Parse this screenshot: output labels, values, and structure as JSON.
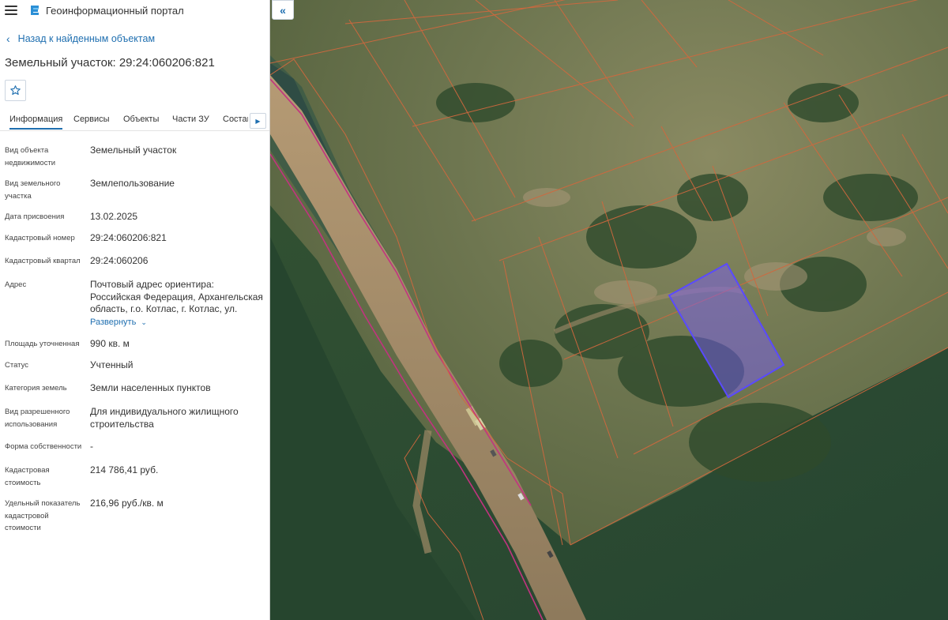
{
  "app": {
    "title": "Геоинформационный портал"
  },
  "nav": {
    "back_label": "Назад к найденным объектам"
  },
  "page_title": "Земельный участок: 29:24:060206:821",
  "tabs": [
    {
      "label": "Информация",
      "active": true
    },
    {
      "label": "Сервисы",
      "active": false
    },
    {
      "label": "Объекты",
      "active": false
    },
    {
      "label": "Части ЗУ",
      "active": false
    },
    {
      "label": "Состав",
      "active": false
    }
  ],
  "properties": [
    {
      "label": "Вид объекта недвижимости",
      "value": "Земельный участок"
    },
    {
      "label": "Вид земельного участка",
      "value": "Землепользование"
    },
    {
      "label": "Дата присвоения",
      "value": "13.02.2025"
    },
    {
      "label": "Кадастровый номер",
      "value": "29:24:060206:821"
    },
    {
      "label": "Кадастровый квартал",
      "value": "29:24:060206"
    },
    {
      "label": "Адрес",
      "value": "Почтовый адрес ориентира: Российская Федерация, Архангельская область, г.о. Котлас, г. Котлас, ул.",
      "expand_label": "Развернуть"
    },
    {
      "label": "Площадь уточненная",
      "value": "990 кв. м"
    },
    {
      "label": "Статус",
      "value": "Учтенный"
    },
    {
      "label": "Категория земель",
      "value": "Земли населенных пунктов"
    },
    {
      "label": "Вид разрешенного использования",
      "value": "Для индивидуального жилищного строительства"
    },
    {
      "label": "Форма собственности",
      "value": "-"
    },
    {
      "label": "Кадастровая стоимость",
      "value": "214 786,41 руб."
    },
    {
      "label": "Удельный показатель кадастровой стоимости",
      "value": "216,96 руб./кв. м"
    }
  ],
  "icons": {
    "menu": "hamburger-icon",
    "logo": "portal-logo-icon",
    "back": "chevron-left-icon",
    "favorite": "star-outline-icon",
    "tabs_next": "triangle-right-icon",
    "collapse": "double-chevron-left-icon"
  },
  "colors": {
    "accent": "#1f6fb0",
    "parcel_lines": "#d0683e",
    "selected_parcel_fill": "#7b5cff",
    "selected_parcel_stroke": "#5a4aff",
    "boundary_line": "#c2337f"
  }
}
